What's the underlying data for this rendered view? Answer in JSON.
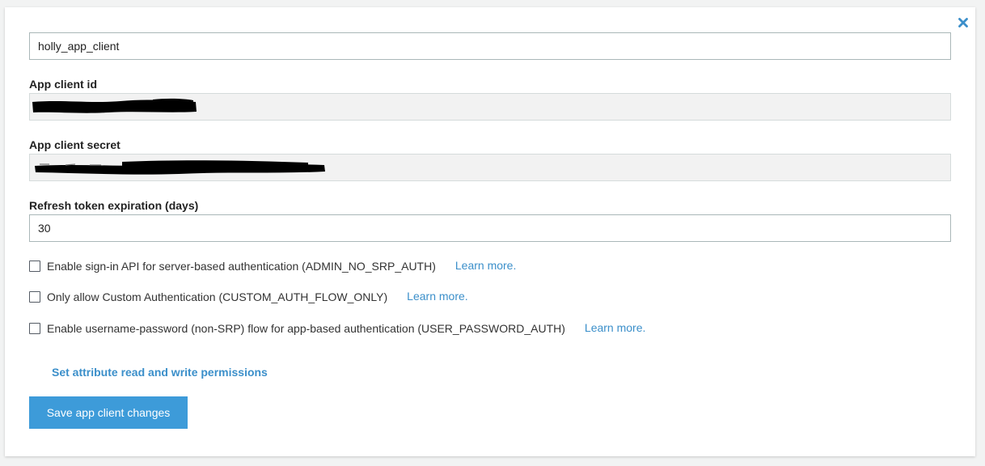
{
  "app_client": {
    "name_value": "holly_app_client",
    "client_id_label": "App client id",
    "client_secret_label": "App client secret",
    "refresh_token_label": "Refresh token expiration (days)",
    "refresh_token_value": "30"
  },
  "options": [
    {
      "label": "Enable sign-in API for server-based authentication (ADMIN_NO_SRP_AUTH)",
      "link": "Learn more.",
      "checked": false
    },
    {
      "label": "Only allow Custom Authentication (CUSTOM_AUTH_FLOW_ONLY)",
      "link": "Learn more.",
      "checked": false
    },
    {
      "label": "Enable username-password (non-SRP) flow for app-based authentication (USER_PASSWORD_AUTH)",
      "link": "Learn more.",
      "checked": false
    }
  ],
  "permissions_link": "Set attribute read and write permissions",
  "save_button": "Save app client changes",
  "colors": {
    "accent": "#3d9bd9",
    "link": "#3b8fca"
  },
  "icons": {
    "close": "close-icon"
  }
}
